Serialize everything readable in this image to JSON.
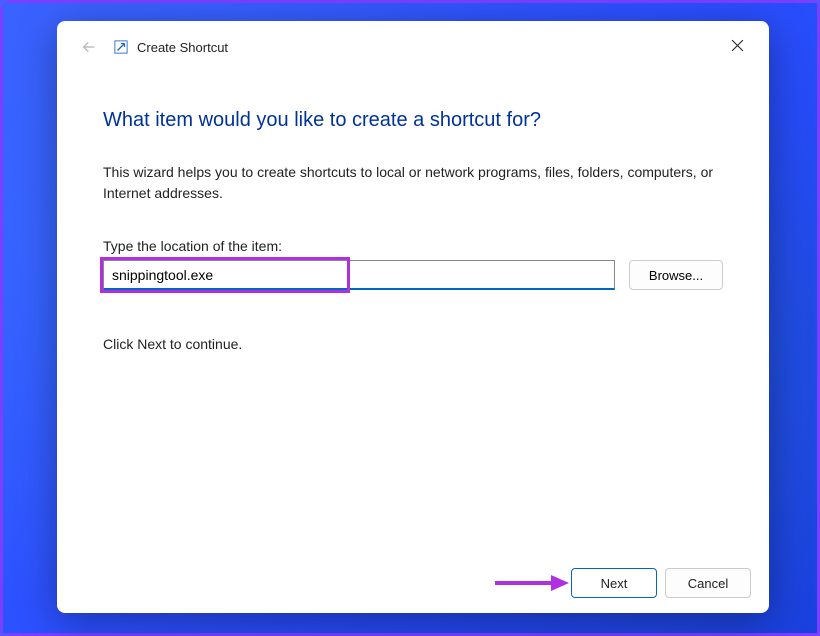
{
  "dialog": {
    "title": "Create Shortcut",
    "heading": "What item would you like to create a shortcut for?",
    "description": "This wizard helps you to create shortcuts to local or network programs, files, folders, computers, or Internet addresses.",
    "location_label": "Type the location of the item:",
    "location_value": "snippingtool.exe",
    "browse_label": "Browse...",
    "continue_text": "Click Next to continue.",
    "next_label": "Next",
    "cancel_label": "Cancel"
  }
}
